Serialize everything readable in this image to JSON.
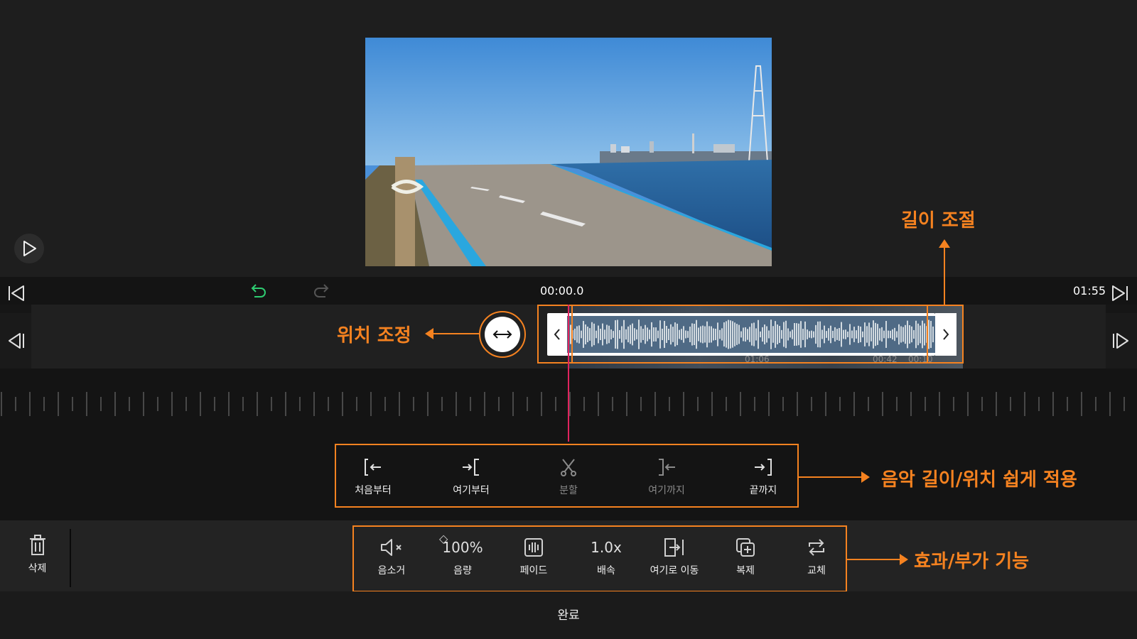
{
  "header": {
    "current_time": "00:00.0",
    "total_time": "01:55"
  },
  "clip": {
    "timestamp_1": "01:06",
    "timestamp_2": "00:42",
    "timestamp_3": "00:10"
  },
  "edit_tools": [
    {
      "label": "처음부터",
      "icon": "trim-from-start-icon",
      "enabled": true
    },
    {
      "label": "여기부터",
      "icon": "trim-from-here-icon",
      "enabled": true
    },
    {
      "label": "분할",
      "icon": "scissors-icon",
      "enabled": false
    },
    {
      "label": "여기까지",
      "icon": "trim-to-here-icon",
      "enabled": false
    },
    {
      "label": "끝까지",
      "icon": "trim-to-end-icon",
      "enabled": true
    }
  ],
  "bottom_tools": {
    "delete": "삭제",
    "items": [
      {
        "label": "음소거",
        "icon": "mute-icon"
      },
      {
        "label": "음량",
        "value": "100%"
      },
      {
        "label": "페이드",
        "icon": "fade-icon"
      },
      {
        "label": "배속",
        "value": "1.0x"
      },
      {
        "label": "여기로 이동",
        "icon": "move-here-icon"
      },
      {
        "label": "복제",
        "icon": "duplicate-icon"
      },
      {
        "label": "교체",
        "icon": "replace-icon"
      }
    ]
  },
  "footer": {
    "done_label": "완료"
  },
  "annotations": {
    "length_adjust": "길이 조절",
    "position_adjust": "위치 조정",
    "easy_apply": "음악 길이/위치 쉽게 적용",
    "effects": "효과/부가 기능"
  },
  "colors": {
    "accent_orange": "#f58220",
    "playhead": "#e0245e",
    "undo_green": "#2ecc71"
  }
}
